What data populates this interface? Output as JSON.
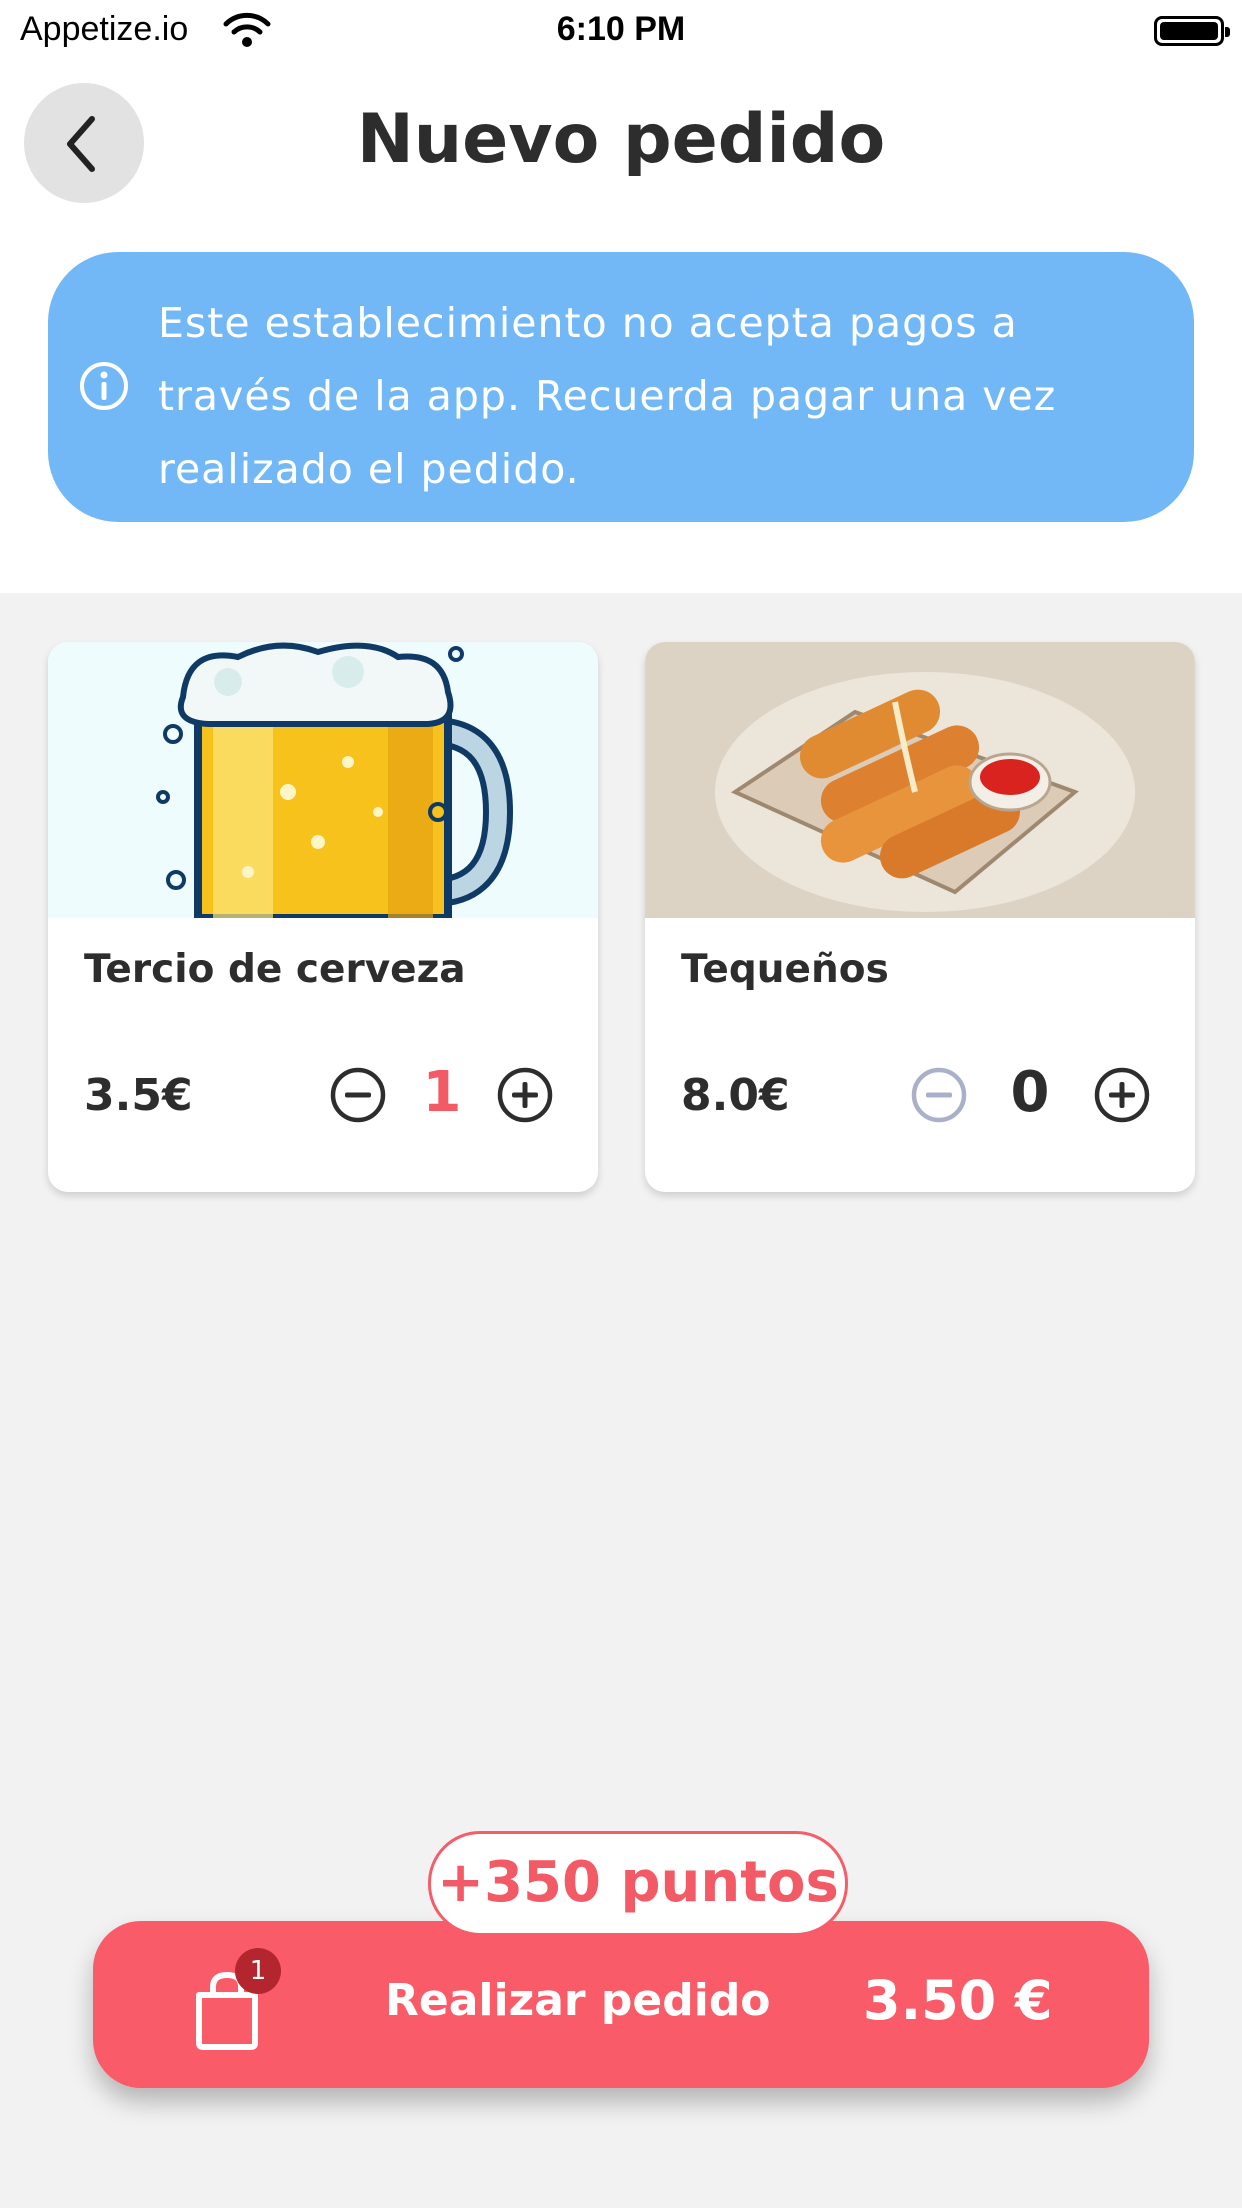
{
  "status_bar": {
    "carrier": "Appetize.io",
    "time": "6:10 PM"
  },
  "header": {
    "title": "Nuevo pedido",
    "back_icon": "chevron-left-icon"
  },
  "notice": {
    "icon": "info-icon",
    "text": "Este establecimiento no acepta pagos a través de la app. Recuerda pagar una vez realizado el pedido.",
    "background": "#72b8f6"
  },
  "products": [
    {
      "name": "Tercio de cerveza",
      "price": "3.5€",
      "quantity": "1",
      "image": "beer-mug-illustration"
    },
    {
      "name": "Tequeños",
      "price": "8.0€",
      "quantity": "0",
      "image": "tequenos-plate-illustration"
    }
  ],
  "order": {
    "points": "+350 puntos",
    "button_label": "Realizar pedido",
    "total": "3.50 €",
    "cart_count": "1",
    "cart_icon": "shopping-bag-icon"
  },
  "colors": {
    "accent": "#f95b68",
    "badge": "#b3262d",
    "text": "#2d2d2d",
    "disabled": "#a9b0c8"
  }
}
